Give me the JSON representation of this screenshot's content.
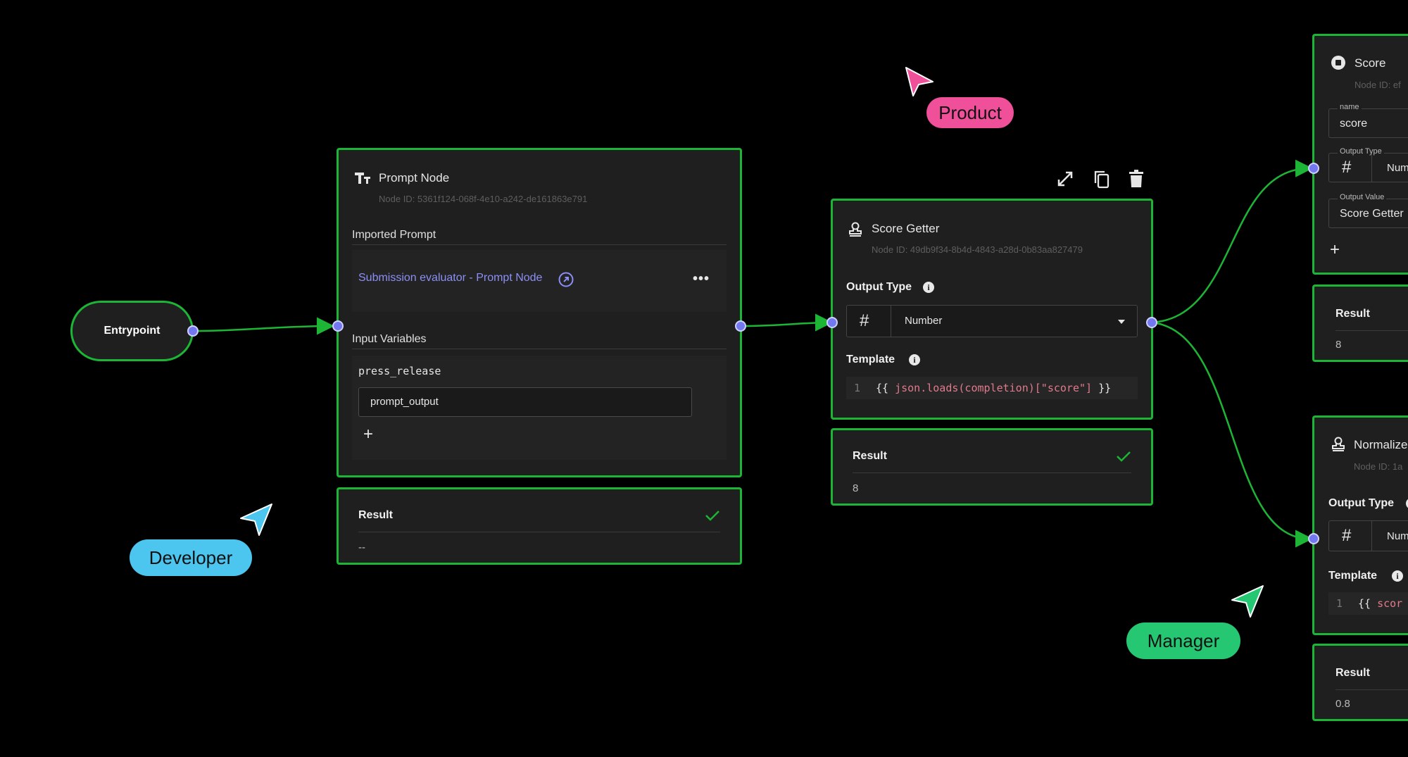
{
  "entrypoint": {
    "label": "Entrypoint"
  },
  "prompt_node": {
    "title": "Prompt Node",
    "node_id": "Node ID: 5361f124-068f-4e10-a242-de161863e791",
    "imported_prompt_label": "Imported Prompt",
    "prompt_link": "Submission evaluator - Prompt Node",
    "input_variables_label": "Input Variables",
    "variable_name": "press_release",
    "variable_value": "prompt_output",
    "add_label": "+",
    "result_label": "Result",
    "result_value": "--"
  },
  "score_getter": {
    "title": "Score Getter",
    "node_id": "Node ID: 49db9f34-8b4d-4843-a28d-0b83aa827479",
    "output_type_label": "Output Type",
    "output_type_value": "Number",
    "template_label": "Template",
    "template_line_number": "1",
    "template_code_open": "{{ ",
    "template_code_body": "json.loads(completion)[\"score\"]",
    "template_code_close": " }}",
    "result_label": "Result",
    "result_value": "8"
  },
  "score_node": {
    "title": "Score",
    "node_id": "Node ID: ef",
    "name_label": "name",
    "name_value": "score",
    "output_type_label": "Output Type",
    "output_type_value": "Num",
    "output_value_label": "Output Value",
    "output_value_value": "Score Getter",
    "add_label": "+",
    "result_label": "Result",
    "result_value": "8"
  },
  "normalize_node": {
    "title": "Normalize",
    "node_id": "Node ID: 1a",
    "output_type_label": "Output Type",
    "output_type_value": "Num",
    "template_label": "Template",
    "template_line_number": "1",
    "template_code_open": "{{ ",
    "template_code_body": "scor",
    "result_label": "Result",
    "result_value": "0.8"
  },
  "toolbar": {
    "icons": [
      "expand-icon",
      "copy-icon",
      "trash-icon"
    ]
  },
  "cursors": {
    "product": {
      "label": "Product",
      "color": "#f0509a"
    },
    "developer": {
      "label": "Developer",
      "color": "#4cc6ef"
    },
    "manager": {
      "label": "Manager",
      "color": "#26c773"
    }
  },
  "colors": {
    "border_green": "#1db535",
    "handle": "#7378f0",
    "link": "#8b8ff5",
    "node_bg": "#1f1f1f"
  }
}
